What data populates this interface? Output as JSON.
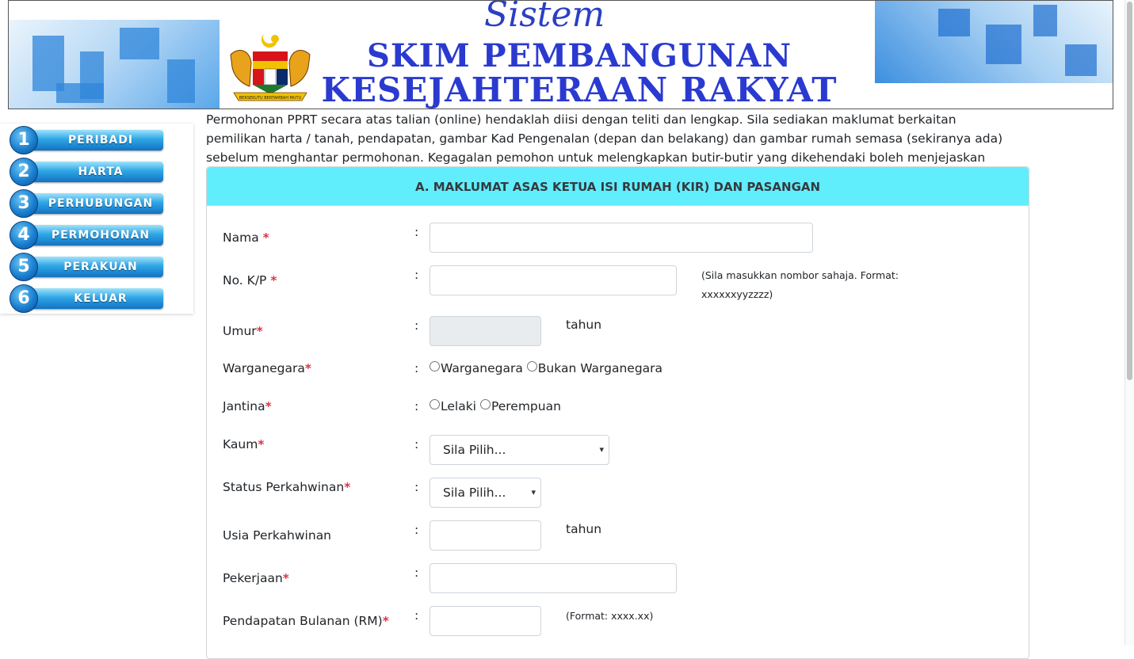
{
  "banner": {
    "title_small": "Sistem",
    "title_line1": "SKIM PEMBANGUNAN",
    "title_line2": "KESEJAHTERAAN RAKYAT",
    "crest_icon": "malaysia-coat-of-arms",
    "crest_motto": "BERSEKUTU BERTAMBAH MUTU"
  },
  "sidebar": {
    "items": [
      {
        "number": "1",
        "label": "PERIBADI"
      },
      {
        "number": "2",
        "label": "HARTA"
      },
      {
        "number": "3",
        "label": "PERHUBUNGAN"
      },
      {
        "number": "4",
        "label": "PERMOHONAN"
      },
      {
        "number": "5",
        "label": "PERAKUAN"
      },
      {
        "number": "6",
        "label": "KELUAR"
      }
    ]
  },
  "intro": "Permohonan PPRT secara atas talian (online) hendaklah diisi dengan teliti dan lengkap. Sila sediakan maklumat berkaitan pemilikan harta / tanah, pendapatan, gambar Kad Pengenalan (depan dan belakang) dan gambar rumah semasa (sekiranya ada) sebelum menghantar permohonan. Kegagalan pemohon untuk melengkapkan butir-butir yang dikehendaki boleh menjejaskan permohonan.",
  "form": {
    "header": "A. MAKLUMAT ASAS KETUA ISI RUMAH (KIR) DAN PASANGAN",
    "colon": ":",
    "required_mark": "*",
    "nama": {
      "label": "Nama ",
      "value": ""
    },
    "nokp": {
      "label": "No. K/P ",
      "value": "",
      "note_line1": "(Sila masukkan nombor sahaja. Format:",
      "note_line2": "xxxxxxyyzzzz)"
    },
    "umur": {
      "label": "Umur",
      "value": "",
      "unit": "tahun"
    },
    "warganegara": {
      "label": "Warganegara",
      "options": [
        "Warganegara",
        "Bukan Warganegara"
      ]
    },
    "jantina": {
      "label": "Jantina",
      "options": [
        "Lelaki",
        "Perempuan"
      ]
    },
    "kaum": {
      "label": "Kaum",
      "selected": "Sila Pilih..."
    },
    "status": {
      "label": "Status Perkahwinan",
      "selected": "Sila Pilih..."
    },
    "usia": {
      "label": "Usia Perkahwinan",
      "value": "",
      "unit": "tahun"
    },
    "pekerjaan": {
      "label": "Pekerjaan",
      "value": ""
    },
    "pendapatan": {
      "label": "Pendapatan Bulanan (RM)",
      "value": "",
      "note": "(Format: xxxx.xx)"
    }
  },
  "colors": {
    "header_bg": "#60eefd",
    "required": "#dc3545",
    "banner_title": "#2a3ad0"
  }
}
